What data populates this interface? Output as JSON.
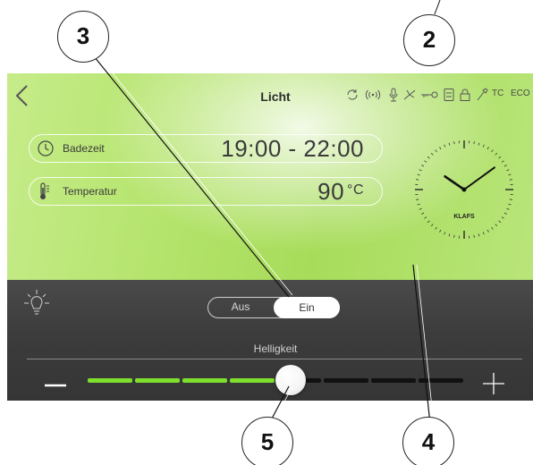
{
  "header": {
    "title": "Licht",
    "status_icons": [
      "refresh-icon",
      "signal-icon",
      "microphone-icon",
      "fan-icon",
      "key-icon",
      "storage-icon",
      "lock-icon",
      "wrench-icon"
    ],
    "status_tc": "TC",
    "status_eco": "ECO"
  },
  "info": {
    "badezeit": {
      "icon": "clock-icon",
      "label": "Badezeit",
      "value": "19:00 - 22:00"
    },
    "temperatur": {
      "icon": "thermometer-icon",
      "label": "Temperatur",
      "value": "90",
      "unit": "°C"
    }
  },
  "clock": {
    "brand": "KLAFS",
    "hour": 10,
    "minute": 9
  },
  "light": {
    "toggle_off": "Aus",
    "toggle_on": "Ein",
    "selected": "Ein",
    "brightness_label": "Helligkeit",
    "brightness_level": 0.54,
    "active_color": "#7ee02d",
    "inactive_color": "#111111"
  },
  "callouts": [
    "2",
    "3",
    "4",
    "5"
  ]
}
